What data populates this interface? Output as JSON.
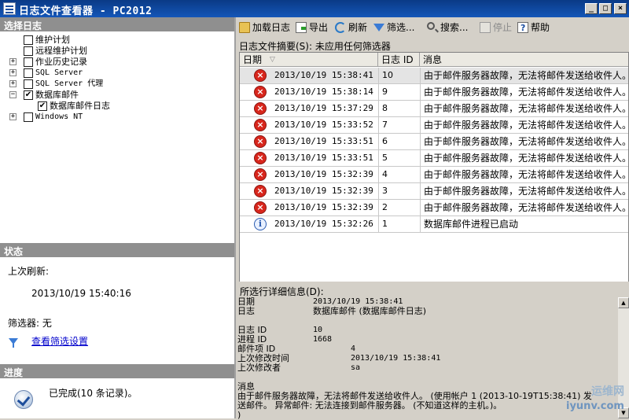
{
  "window": {
    "title": "日志文件查看器 - PC2012"
  },
  "left": {
    "select_log_header": "选择日志",
    "tree": [
      {
        "label": "维护计划",
        "expander": "",
        "checked": ""
      },
      {
        "label": "远程维护计划",
        "expander": "",
        "checked": ""
      },
      {
        "label": "作业历史记录",
        "expander": "+",
        "checked": ""
      },
      {
        "label": "SQL Server",
        "expander": "+",
        "checked": ""
      },
      {
        "label": "SQL Server 代理",
        "expander": "+",
        "checked": ""
      },
      {
        "label": "数据库邮件",
        "expander": "−",
        "checked": "✔"
      },
      {
        "label": "数据库邮件日志",
        "expander": "",
        "checked": "✔"
      },
      {
        "label": "Windows NT",
        "expander": "+",
        "checked": ""
      }
    ],
    "status_header": "状态",
    "last_refresh_label": "上次刷新:",
    "last_refresh_value": "2013/10/19 15:40:16",
    "filter_label": "筛选器: 无",
    "filter_link": "查看筛选设置",
    "progress_header": "进度",
    "progress_text": "已完成(10 条记录)。"
  },
  "toolbar": {
    "load": "加载日志",
    "export": "导出",
    "refresh": "刷新",
    "filter": "筛选...",
    "search": "搜索...",
    "stop": "停止",
    "help": "帮助"
  },
  "summary": "日志文件摘要(S): 未应用任何筛选器",
  "grid": {
    "columns": {
      "date": "日期",
      "log_id": "日志 ID",
      "message": "消息"
    },
    "rows": [
      {
        "icon": "error-icon",
        "date": "2013/10/19 15:38:41",
        "id": "10",
        "message": "由于邮件服务器故障，无法将邮件发送给收件人。"
      },
      {
        "icon": "error-icon",
        "date": "2013/10/19 15:38:14",
        "id": "9",
        "message": "由于邮件服务器故障，无法将邮件发送给收件人。"
      },
      {
        "icon": "error-icon",
        "date": "2013/10/19 15:37:29",
        "id": "8",
        "message": "由于邮件服务器故障，无法将邮件发送给收件人。"
      },
      {
        "icon": "error-icon",
        "date": "2013/10/19 15:33:52",
        "id": "7",
        "message": "由于邮件服务器故障，无法将邮件发送给收件人。"
      },
      {
        "icon": "error-icon",
        "date": "2013/10/19 15:33:51",
        "id": "6",
        "message": "由于邮件服务器故障，无法将邮件发送给收件人。"
      },
      {
        "icon": "error-icon",
        "date": "2013/10/19 15:33:51",
        "id": "5",
        "message": "由于邮件服务器故障，无法将邮件发送给收件人。"
      },
      {
        "icon": "error-icon",
        "date": "2013/10/19 15:32:39",
        "id": "4",
        "message": "由于邮件服务器故障，无法将邮件发送给收件人。"
      },
      {
        "icon": "error-icon",
        "date": "2013/10/19 15:32:39",
        "id": "3",
        "message": "由于邮件服务器故障，无法将邮件发送给收件人。"
      },
      {
        "icon": "error-icon",
        "date": "2013/10/19 15:32:39",
        "id": "2",
        "message": "由于邮件服务器故障，无法将邮件发送给收件人。"
      },
      {
        "icon": "info-icon",
        "date": "2013/10/19 15:32:26",
        "id": "1",
        "message": "数据库邮件进程已启动"
      }
    ]
  },
  "details": {
    "header": "所选行详细信息(D):",
    "date_label": "日期",
    "date_value": "2013/10/19 15:38:41",
    "log_label": "日志",
    "log_value": "数据库邮件 (数据库邮件日志)",
    "log_id_label": "日志 ID",
    "log_id_value": "10",
    "process_id_label": "进程 ID",
    "process_id_value": "1668",
    "mail_item_id_label": "邮件项 ID",
    "mail_item_id_value": "4",
    "last_modified_label": "上次修改时间",
    "last_modified_value": "2013/10/19 15:38:41",
    "modified_by_label": "上次修改者",
    "modified_by_value": "sa",
    "message_label": "消息",
    "message_line1": "由于邮件服务器故障，无法将邮件发送给收件人。 (使用帐户 1 (2013-10-19T15:38:41) 发",
    "message_line2": "送邮件。 异常邮件: 无法连接到邮件服务器。 (不知道这样的主机。)。",
    "message_line3": ")"
  },
  "watermark": {
    "line1": "运维网",
    "line2": "iyunv.com"
  }
}
